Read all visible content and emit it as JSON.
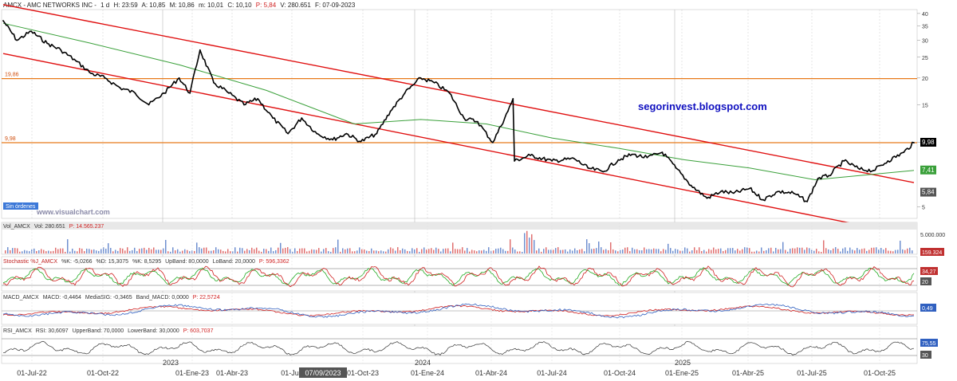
{
  "header": {
    "ticker": "AMCX - AMC NETWORKS INC -",
    "timeframe": "1 d",
    "hora": "H: 23:59",
    "open": "A: 10,85",
    "high": "M: 10,86",
    "low": "m: 10,01",
    "close": "C: 10,10",
    "pct": "P: 5,84",
    "vol": "V: 280.651",
    "date": "F: 07-09-2023"
  },
  "watermark_blog": "segorinvest.blogspot.com",
  "watermark_vc": "www.visualchart.com",
  "sin_ordenes": "Sin órdenes",
  "level_labels": {
    "resistance": "19,86",
    "support": "9,98"
  },
  "price_axis_ticks": [
    "40",
    "35",
    "30",
    "25",
    "20",
    "15",
    "10",
    "5"
  ],
  "price_tags": {
    "last": "9,98",
    "ma": "7,41",
    "other": "5,84"
  },
  "colors": {
    "price": "#000000",
    "ma": "#3aa03a",
    "channel": "#e01010",
    "levels": "#e87a1a",
    "stoch_k": "#d02020",
    "stoch_d": "#22aa22",
    "macd": "#3060c0",
    "signal": "#d02020"
  },
  "time_axis": {
    "labels": [
      "01-Jul-22",
      "01-Oct-22",
      "2023",
      "01-Ene-23",
      "01-Abr-23",
      "01-Jul-",
      "07/09/2023",
      "01-Oct-23",
      "2024",
      "01-Ene-24",
      "01-Abr-24",
      "01-Jul-24",
      "01-Oct-24",
      "2025",
      "01-Ene-25",
      "01-Abr-25",
      "01-Jul-25",
      "01-Oct-25"
    ]
  },
  "volume_panel": {
    "title": "Vol_AMCX",
    "vol": "Vol: 280.651",
    "p": "P: 14.565.237",
    "axis_label": "5.000.000",
    "tag": "159.324"
  },
  "stoch_panel": {
    "title": "Stochastic %J_AMCX",
    "k": "%K: -5,0266",
    "d": "%D: 15,3075",
    "kk": "%K: 8,5295",
    "up": "UpBand: 80,0000",
    "lo": "LoBand: 20,0000",
    "p": "P: 596,3362",
    "tag": "34,27",
    "tag2": "20"
  },
  "macd_panel": {
    "title": "MACD_AMCX",
    "macd": "MACD: -0,4464",
    "sig": "MediaSIG: -0,3465",
    "band": "Band_MACD: 0,0000",
    "p": "P: 22,5724",
    "tag": "0,49"
  },
  "rsi_panel": {
    "title": "RSI_AMCX",
    "rsi": "RSI: 30,6097",
    "ub": "UpperBand: 70,0000",
    "lb": "LowerBand: 30,0000",
    "p": "P: 603,7037",
    "tag": "75,55",
    "tag2": "30"
  },
  "chart_data": {
    "type": "line",
    "title": "AMCX - AMC NETWORKS INC - 1 d",
    "log_scale": true,
    "ylim": [
      4.5,
      41
    ],
    "y_ticks": [
      40,
      35,
      30,
      25,
      20,
      15,
      10,
      5
    ],
    "x_range": [
      "2022-06-01",
      "2025-11-15"
    ],
    "price_series": {
      "name": "AMCX",
      "x": [
        "2022-06-01",
        "2022-06-20",
        "2022-07-10",
        "2022-08-01",
        "2022-08-20",
        "2022-09-10",
        "2022-10-01",
        "2022-10-20",
        "2022-11-10",
        "2022-12-01",
        "2022-12-20",
        "2023-01-10",
        "2023-01-31",
        "2023-02-15",
        "2023-03-01",
        "2023-03-20",
        "2023-04-10",
        "2023-05-01",
        "2023-05-20",
        "2023-06-10",
        "2023-07-01",
        "2023-07-20",
        "2023-08-10",
        "2023-09-01",
        "2023-09-20",
        "2023-10-10",
        "2023-11-01",
        "2023-11-20",
        "2023-12-10",
        "2024-01-01",
        "2024-01-20",
        "2024-02-10",
        "2024-03-01",
        "2024-03-20",
        "2024-04-10",
        "2024-05-01",
        "2024-05-08",
        "2024-05-10",
        "2024-06-01",
        "2024-07-01",
        "2024-08-01",
        "2024-08-20",
        "2024-09-10",
        "2024-10-01",
        "2024-10-20",
        "2024-11-10",
        "2024-12-01",
        "2024-12-20",
        "2025-01-10",
        "2025-02-01",
        "2025-02-20",
        "2025-03-10",
        "2025-04-01",
        "2025-04-20",
        "2025-05-10",
        "2025-06-01",
        "2025-06-20",
        "2025-07-05",
        "2025-07-20",
        "2025-08-10",
        "2025-09-01",
        "2025-09-20",
        "2025-10-10",
        "2025-11-01",
        "2025-11-15"
      ],
      "y": [
        37,
        30,
        33,
        29,
        27,
        24,
        21,
        20,
        18,
        17,
        15,
        17,
        20,
        17,
        27,
        19,
        17,
        15,
        16,
        13,
        11,
        13,
        11,
        10.3,
        11,
        10.1,
        11,
        14,
        17,
        20,
        19,
        17,
        13,
        12.5,
        10,
        14,
        16,
        8.2,
        8.7,
        8.2,
        8.4,
        7.6,
        7.3,
        8.3,
        8.8,
        8.5,
        9,
        7.6,
        6.3,
        5.5,
        5.9,
        5.8,
        6.1,
        5.4,
        5.9,
        5.8,
        5.3,
        6.8,
        7,
        8.2,
        7.5,
        7.4,
        8.2,
        9.0,
        9.98
      ]
    },
    "moving_average": {
      "name": "MA",
      "x": [
        "2022-06-01",
        "2022-10-01",
        "2023-02-01",
        "2023-06-01",
        "2023-10-01",
        "2024-01-01",
        "2024-04-01",
        "2024-07-01",
        "2024-10-01",
        "2025-01-01",
        "2025-04-01",
        "2025-07-01",
        "2025-11-15"
      ],
      "y": [
        36,
        29,
        23,
        17.5,
        12.2,
        12.8,
        12.2,
        10.5,
        9.4,
        8.3,
        7.6,
        6.7,
        7.41
      ]
    },
    "channel_upper": {
      "x": [
        "2022-06-01",
        "2025-11-15"
      ],
      "y": [
        44,
        6.5
      ]
    },
    "channel_lower": {
      "x": [
        "2022-06-01",
        "2025-08-20"
      ],
      "y": [
        26,
        4.2
      ]
    },
    "resistance_level": 19.86,
    "support_level": 9.98
  }
}
